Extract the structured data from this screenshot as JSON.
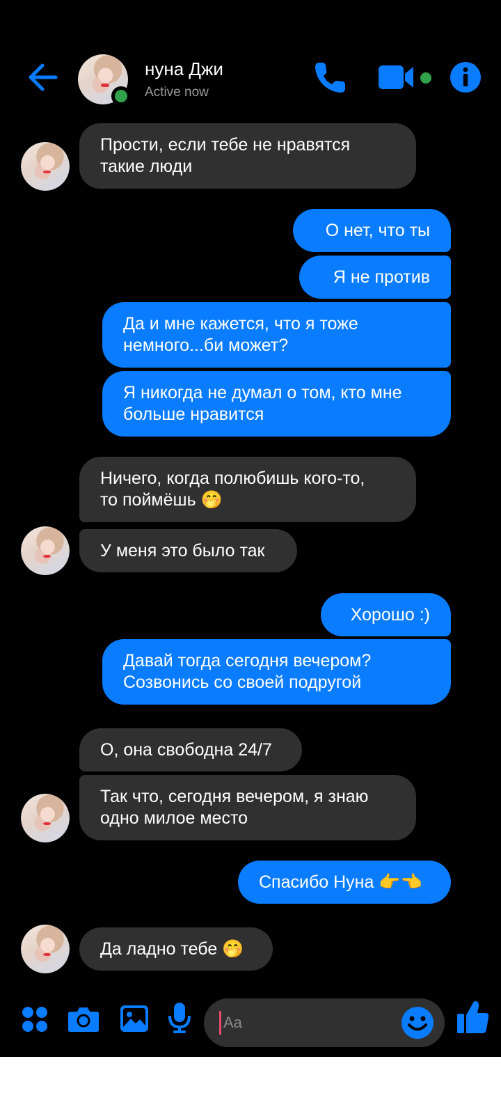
{
  "header": {
    "name": "нуна Джи",
    "status": "Active now"
  },
  "colors": {
    "accent": "#0a7cff",
    "incoming_bubble": "#303030",
    "online": "#31a24c",
    "background": "#000000"
  },
  "messages": [
    {
      "dir": "in",
      "text": "Прости, если тебе не нравятся\nтакие люди"
    },
    {
      "dir": "out",
      "text": "О нет, что ты"
    },
    {
      "dir": "out",
      "text": "Я не против"
    },
    {
      "dir": "out",
      "text": "Да и мне кажется, что я тоже\nнемного...би может?"
    },
    {
      "dir": "out",
      "text": "Я никогда не думал о том, кто мне\nбольше нравится"
    },
    {
      "dir": "in",
      "text": "Ничего, когда полюбишь кого-то,\nто поймёшь 🤭"
    },
    {
      "dir": "in",
      "text": "У меня это было так"
    },
    {
      "dir": "out",
      "text": "Хорошо :)"
    },
    {
      "dir": "out",
      "text": "Давай тогда сегодня вечером?\nСозвонись со своей подругой"
    },
    {
      "dir": "in",
      "text": "О, она свободна 24/7"
    },
    {
      "dir": "in",
      "text": "Так что, сегодня вечером, я знаю\nодно милое место"
    },
    {
      "dir": "out",
      "text": "Спасибо Нуна 👉👈"
    },
    {
      "dir": "in",
      "text": "Да ладно тебе 🤭"
    }
  ],
  "composer": {
    "placeholder": "Aa",
    "icons": [
      "apps-icon",
      "camera-icon",
      "gallery-icon",
      "microphone-icon",
      "emoji-icon",
      "thumbs-up-icon"
    ]
  }
}
